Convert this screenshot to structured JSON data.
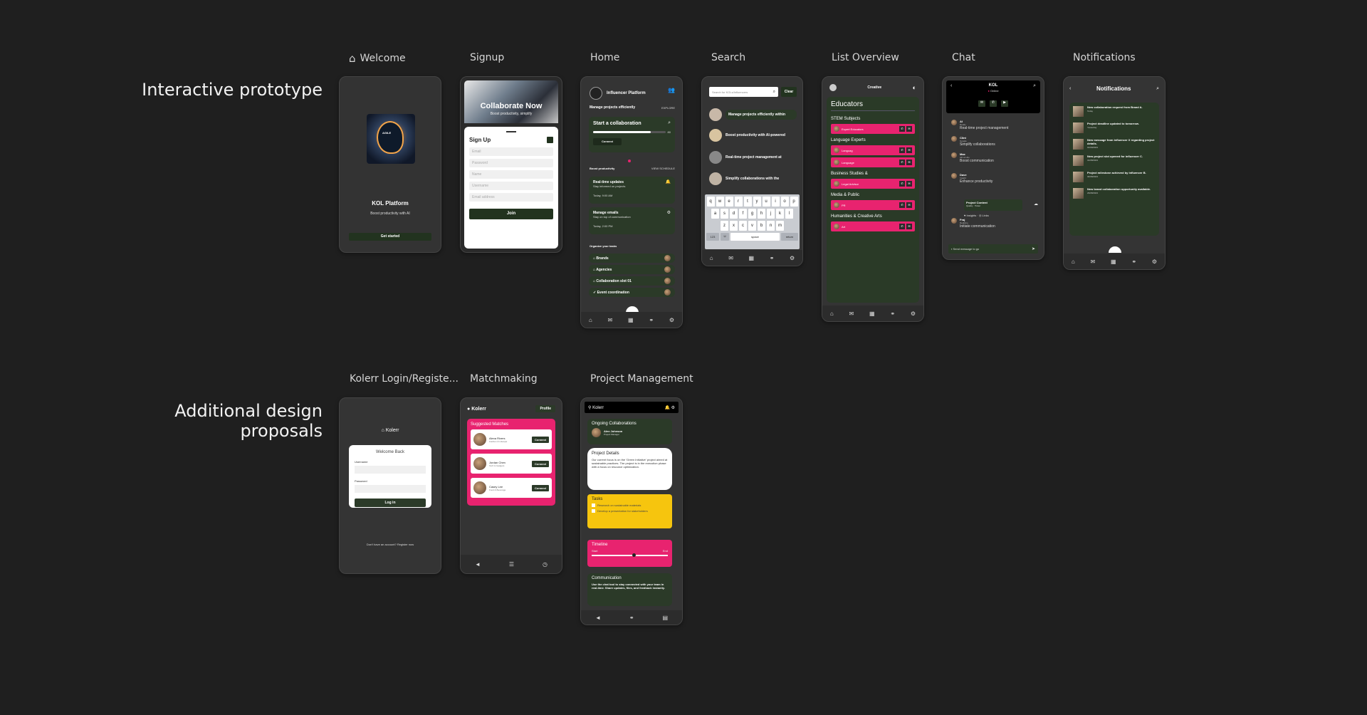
{
  "sections": {
    "prototype": "Interactive prototype",
    "proposals": "Additional design proposals"
  },
  "labels": {
    "welcome": "Welcome",
    "signup": "Signup",
    "home": "Home",
    "search": "Search",
    "list_overview": "List Overview",
    "chat": "Chat",
    "notifications": "Notifications",
    "login": "Kolerr Login/Registe...",
    "matchmaking": "Matchmaking",
    "project_mgmt": "Project Management"
  },
  "welcome": {
    "title": "KOL Platform",
    "subtitle": "Boost productivity with AI",
    "button": "Get started",
    "logo_text": "AGILE"
  },
  "signup": {
    "hero_title": "Collaborate Now",
    "hero_sub": "Boost productivity, simplify",
    "form_title": "Sign Up",
    "fields": [
      "Email",
      "Password",
      "Name",
      "Username",
      "Email address"
    ],
    "button": "Join"
  },
  "home": {
    "brand": "Influencer Platform",
    "headline": "Manage projects efficiently",
    "explore": "EXPLORE",
    "card_title": "Start a collaboration",
    "card_pct": "80",
    "connect": "Connect",
    "section1": "Boost productivity",
    "view_schedule": "VIEW SCHEDULE",
    "cards": [
      {
        "title": "Real-time updates",
        "desc": "Stay informed on projects",
        "time": "Today, 9:00 AM",
        "icon": "🔔"
      },
      {
        "title": "Manage emails",
        "desc": "Stay on top of communication",
        "time": "Today, 2:00 PM",
        "icon": "⚙"
      }
    ],
    "section2": "Organize your tasks",
    "tasks": [
      "Brands",
      "Agencies",
      "Collaboration slot 01",
      "Event coordination"
    ]
  },
  "search": {
    "placeholder": "Search for KOLs/Influencers",
    "clear": "Clear",
    "results": [
      "Manage projects efficiently within",
      "Boost productivity with AI-powered",
      "Real-time project management at",
      "Simplify collaborations with the"
    ],
    "keys_row1": [
      "q",
      "w",
      "e",
      "r",
      "t",
      "y",
      "u",
      "i",
      "o",
      "p"
    ],
    "keys_row2": [
      "a",
      "s",
      "d",
      "f",
      "g",
      "h",
      "j",
      "k",
      "l"
    ],
    "keys_row3": [
      "z",
      "x",
      "c",
      "v",
      "b",
      "n",
      "m"
    ],
    "key_123": "123",
    "key_space": "space",
    "key_return": "return"
  },
  "list": {
    "brand": "Creative",
    "title": "Educators",
    "groups": [
      {
        "name": "STEM Subjects",
        "items": [
          "Expert Educators"
        ]
      },
      {
        "name": "Language Experts",
        "items": [
          "Languag",
          "Language"
        ]
      },
      {
        "name": "Business Studies &",
        "items": [
          "Legal Advisor"
        ]
      },
      {
        "name": "Media & Public",
        "items": [
          "PR"
        ]
      },
      {
        "name": "Humanities & Creative Arts",
        "items": [
          "Art"
        ]
      }
    ]
  },
  "chat": {
    "name": "KOL",
    "status": "Online",
    "messages": [
      {
        "who": "AI",
        "sub": "Ready",
        "text": "Real-time project management"
      },
      {
        "who": "Clint",
        "sub": "Google",
        "text": "Simplify collaborations"
      },
      {
        "who": "Max",
        "sub": "AR at Hire",
        "text": "Boost communication"
      },
      {
        "who": "Dave",
        "sub": "Insight",
        "text": "Enhance productivity"
      },
      {
        "who": "Fraj",
        "sub": "Realtime",
        "text": "Initiate communication"
      }
    ],
    "attachment_title": "Project Content",
    "attachment_sub": "Quality · Tinker",
    "reactions": "♥ Insights · ◎ Links",
    "input_placeholder": "Send message to go"
  },
  "notifications": {
    "title": "Notifications",
    "items": [
      {
        "text": "New collaboration request from Brand A.",
        "time": "Today"
      },
      {
        "text": "Project deadline updated to tomorrow.",
        "time": "Yesterday"
      },
      {
        "text": "New message from influencer X regarding project details.",
        "time": "01/09/2023"
      },
      {
        "text": "New project slot opened for influencer C.",
        "time": "31/08/2023"
      },
      {
        "text": "Project milestone achieved by influencer B.",
        "time": "30/08/2023"
      },
      {
        "text": "New brand collaboration opportunity available.",
        "time": "29/08/2023"
      }
    ]
  },
  "login": {
    "brand": "Kolerr",
    "card_title": "Welcome Back",
    "username": "Username",
    "password": "Password",
    "button": "Log in",
    "footer": "Don't have an account? Register now"
  },
  "match": {
    "brand": "Kolerr",
    "profile": "Profile",
    "title": "Suggested Matches",
    "people": [
      {
        "name": "Alexa Rivers",
        "role": "Fashion & Lifestyle"
      },
      {
        "name": "Jordan Chen",
        "role": "Tech & Gadgets"
      },
      {
        "name": "Casey Lee",
        "role": "Food & Beverage"
      }
    ],
    "connect": "Connect"
  },
  "pm": {
    "brand": "Kolerr",
    "ongoing": "Ongoing Collaborations",
    "person_name": "Alex Johnson",
    "person_role": "Project Manager",
    "details_title": "Project Details",
    "details_text": "Our current focus is on the 'Green Initiative' project aimed at sustainable practices. The project is in the execution phase with a focus on resource optimization.",
    "tasks_title": "Tasks",
    "tasks": [
      "Research on sustainable materials",
      "Develop a presentation for stakeholders"
    ],
    "timeline_title": "Timeline",
    "start": "Start",
    "end": "End",
    "comm_title": "Communication",
    "comm_text": "Use the chat tool to stay connected with your team in real-time. Share updates, files, and feedback instantly."
  }
}
